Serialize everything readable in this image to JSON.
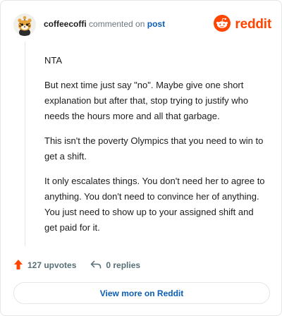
{
  "header": {
    "username": "coffeecoffi",
    "action_text": "commented on",
    "post_link": "post",
    "brand": "reddit",
    "avatar_icon": "snoo-avatar-icon",
    "brand_icon": "reddit-logo-icon",
    "brand_color": "#ff4500"
  },
  "comment": {
    "paragraphs": [
      "NTA",
      "But next time just say \"no\". Maybe give one short explanation but after that, stop trying to justify who needs the hours more and all that garbage.",
      "This isn't the poverty Olympics that you need to win to get a shift.",
      "It only escalates things. You don't need her to agree to anything. You don't need to convince her of anything. You just need to show up to your assigned shift and get paid for it."
    ]
  },
  "actions": {
    "upvotes": "127 upvotes",
    "replies": "0 replies",
    "upvote_icon": "upvote-arrow-icon",
    "reply_icon": "reply-arrow-icon",
    "upvote_color": "#ff4500"
  },
  "footer": {
    "more_label": "View more on Reddit"
  }
}
